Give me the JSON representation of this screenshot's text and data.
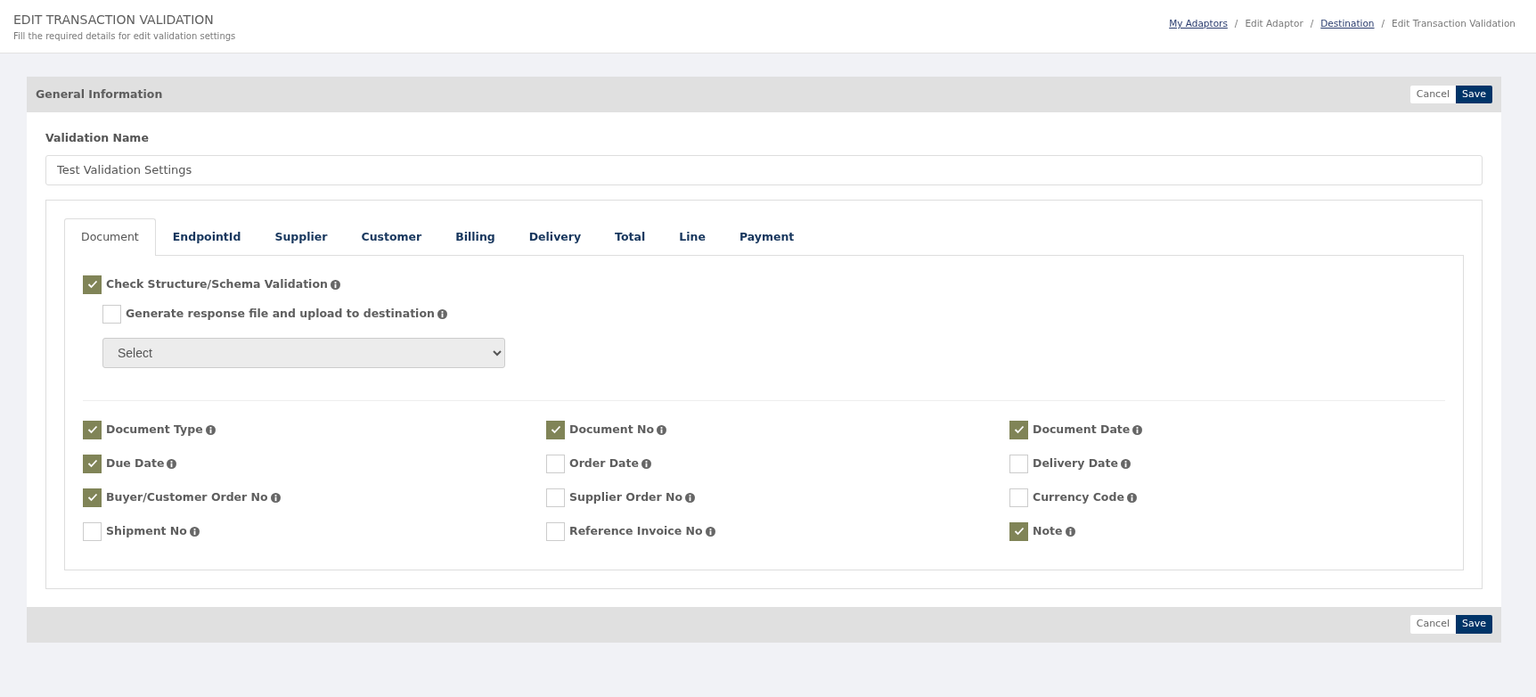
{
  "page_header": {
    "title": "EDIT TRANSACTION VALIDATION",
    "subtitle": "Fill the required details for edit validation settings"
  },
  "breadcrumbs": [
    {
      "label": "My Adaptors",
      "link": true
    },
    {
      "label": "Edit Adaptor",
      "link": false
    },
    {
      "label": "Destination",
      "link": true
    },
    {
      "label": "Edit Transaction Validation",
      "link": false
    }
  ],
  "breadcrumb_separator": "/",
  "panel": {
    "title": "General Information",
    "buttons": [
      "Cancel",
      "Save"
    ]
  },
  "validation_name": {
    "label": "Validation Name",
    "value": "Test Validation Settings"
  },
  "tabs": [
    {
      "label": "Document",
      "selected": true
    },
    {
      "label": "EndpointId",
      "selected": false
    },
    {
      "label": "Supplier",
      "selected": false
    },
    {
      "label": "Customer",
      "selected": false
    },
    {
      "label": "Billing",
      "selected": false
    },
    {
      "label": "Delivery",
      "selected": false
    },
    {
      "label": "Total",
      "selected": false
    },
    {
      "label": "Line",
      "selected": false
    },
    {
      "label": "Payment",
      "selected": false
    }
  ],
  "schema_validation": {
    "label": "Check Structure/Schema Validation",
    "checked": true
  },
  "response_file": {
    "label": "Generate response file and upload to destination",
    "checked": false
  },
  "destination_select": {
    "value": "Select"
  },
  "fields": [
    {
      "label": "Document Type",
      "checked": true
    },
    {
      "label": "Document No",
      "checked": true
    },
    {
      "label": "Document Date",
      "checked": true
    },
    {
      "label": "Due Date",
      "checked": true
    },
    {
      "label": "Order Date",
      "checked": false
    },
    {
      "label": "Delivery Date",
      "checked": false
    },
    {
      "label": "Buyer/Customer Order No",
      "checked": true
    },
    {
      "label": "Supplier Order No",
      "checked": false
    },
    {
      "label": "Currency Code",
      "checked": false
    },
    {
      "label": "Shipment No",
      "checked": false
    },
    {
      "label": "Reference Invoice No",
      "checked": false
    },
    {
      "label": "Note",
      "checked": true
    }
  ],
  "footer_buttons": [
    "Cancel",
    "Save"
  ]
}
